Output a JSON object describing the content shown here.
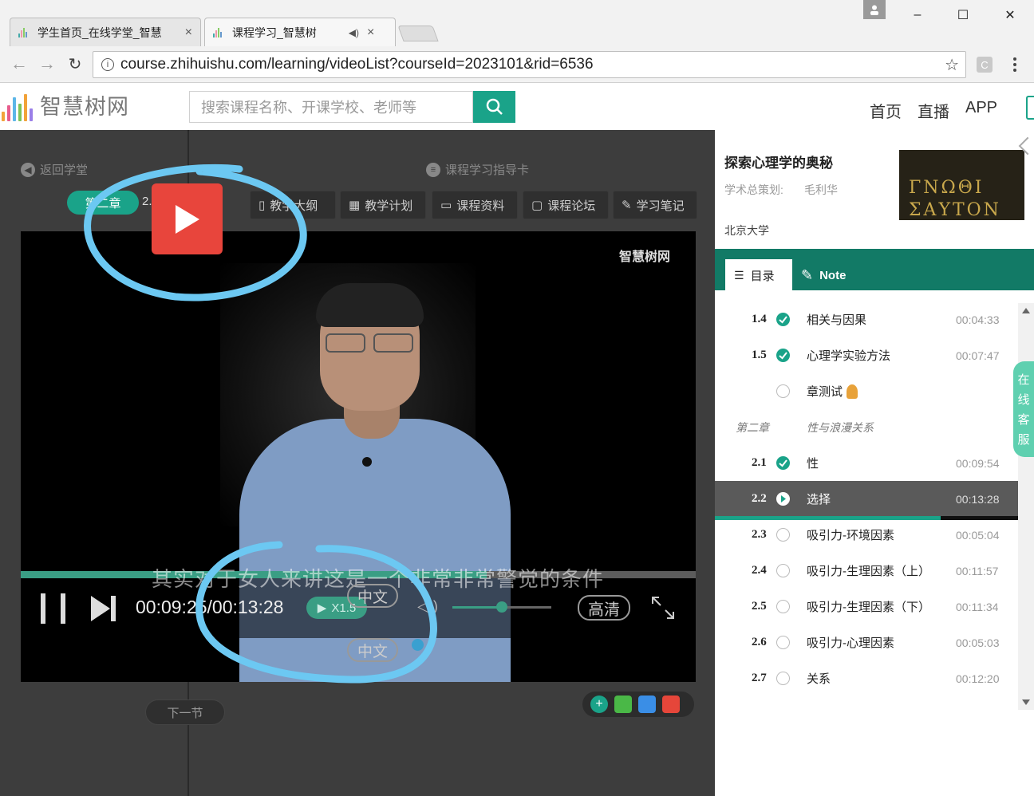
{
  "browser": {
    "tabs": [
      {
        "title": "学生首页_在线学堂_智慧",
        "close": "×"
      },
      {
        "title": "课程学习_智慧树",
        "close": "×"
      }
    ],
    "url": "course.zhihuishu.com/learning/videoList?courseId=2023101&rid=6536",
    "win_controls": {
      "minimize": "–",
      "maximize": "☐",
      "close": "✕"
    }
  },
  "site": {
    "logo_text": "智慧树网",
    "search_placeholder": "搜索课程名称、开课学校、老师等",
    "nav": [
      "首页",
      "直播",
      "APP"
    ]
  },
  "player_page": {
    "back_label": "返回学堂",
    "guide_label": "课程学习指导卡",
    "chapter_pill": "第二章",
    "chapter_num_fragment": "2.",
    "toolbar": [
      "教学大纲",
      "教学计划",
      "课程资料",
      "课程论坛",
      "学习笔记"
    ],
    "watermark": "智慧树网",
    "subtitle": "其实对于女人来讲这是一个非常非常警觉的条件",
    "time_display": "00:09:25/00:13:28",
    "speed": "X1.5",
    "lang_top": "中文",
    "lang_bottom": "中文",
    "quality": "高清",
    "progress_fraction": 0.69,
    "volume_fraction": 0.5,
    "next_label": "下一节",
    "annotation_color": "#6cc8f2"
  },
  "course": {
    "title": "探索心理学的奥秘",
    "planner_label": "学术总策划:",
    "planner_name": "毛利华",
    "school": "北京大学",
    "cover_text": "ΓΝΩΘΙ ΣΑΥΤΟΝ",
    "tabs": {
      "catalog": "目录",
      "note": "Note"
    },
    "lessons": [
      {
        "num": "1.4",
        "title": "相关与因果",
        "time": "00:04:33",
        "status": "done"
      },
      {
        "num": "1.5",
        "title": "心理学实验方法",
        "time": "00:07:47",
        "status": "done"
      },
      {
        "num": "",
        "title": "章测试",
        "time": "",
        "status": "empty"
      },
      {
        "num": "第二章",
        "title": "性与浪漫关系",
        "time": "",
        "status": "chapter"
      },
      {
        "num": "2.1",
        "title": "性",
        "time": "00:09:54",
        "status": "done"
      },
      {
        "num": "2.2",
        "title": "选择",
        "time": "00:13:28",
        "status": "current"
      },
      {
        "num": "2.3",
        "title": "吸引力-环境因素",
        "time": "00:05:04",
        "status": "empty"
      },
      {
        "num": "2.4",
        "title": "吸引力-生理因素（上）",
        "time": "00:11:57",
        "status": "empty"
      },
      {
        "num": "2.5",
        "title": "吸引力-生理因素（下）",
        "time": "00:11:34",
        "status": "empty"
      },
      {
        "num": "2.6",
        "title": "吸引力-心理因素",
        "time": "00:05:03",
        "status": "empty"
      },
      {
        "num": "2.7",
        "title": "关系",
        "time": "00:12:20",
        "status": "empty"
      }
    ],
    "service": [
      "在",
      "线",
      "客",
      "服"
    ]
  }
}
